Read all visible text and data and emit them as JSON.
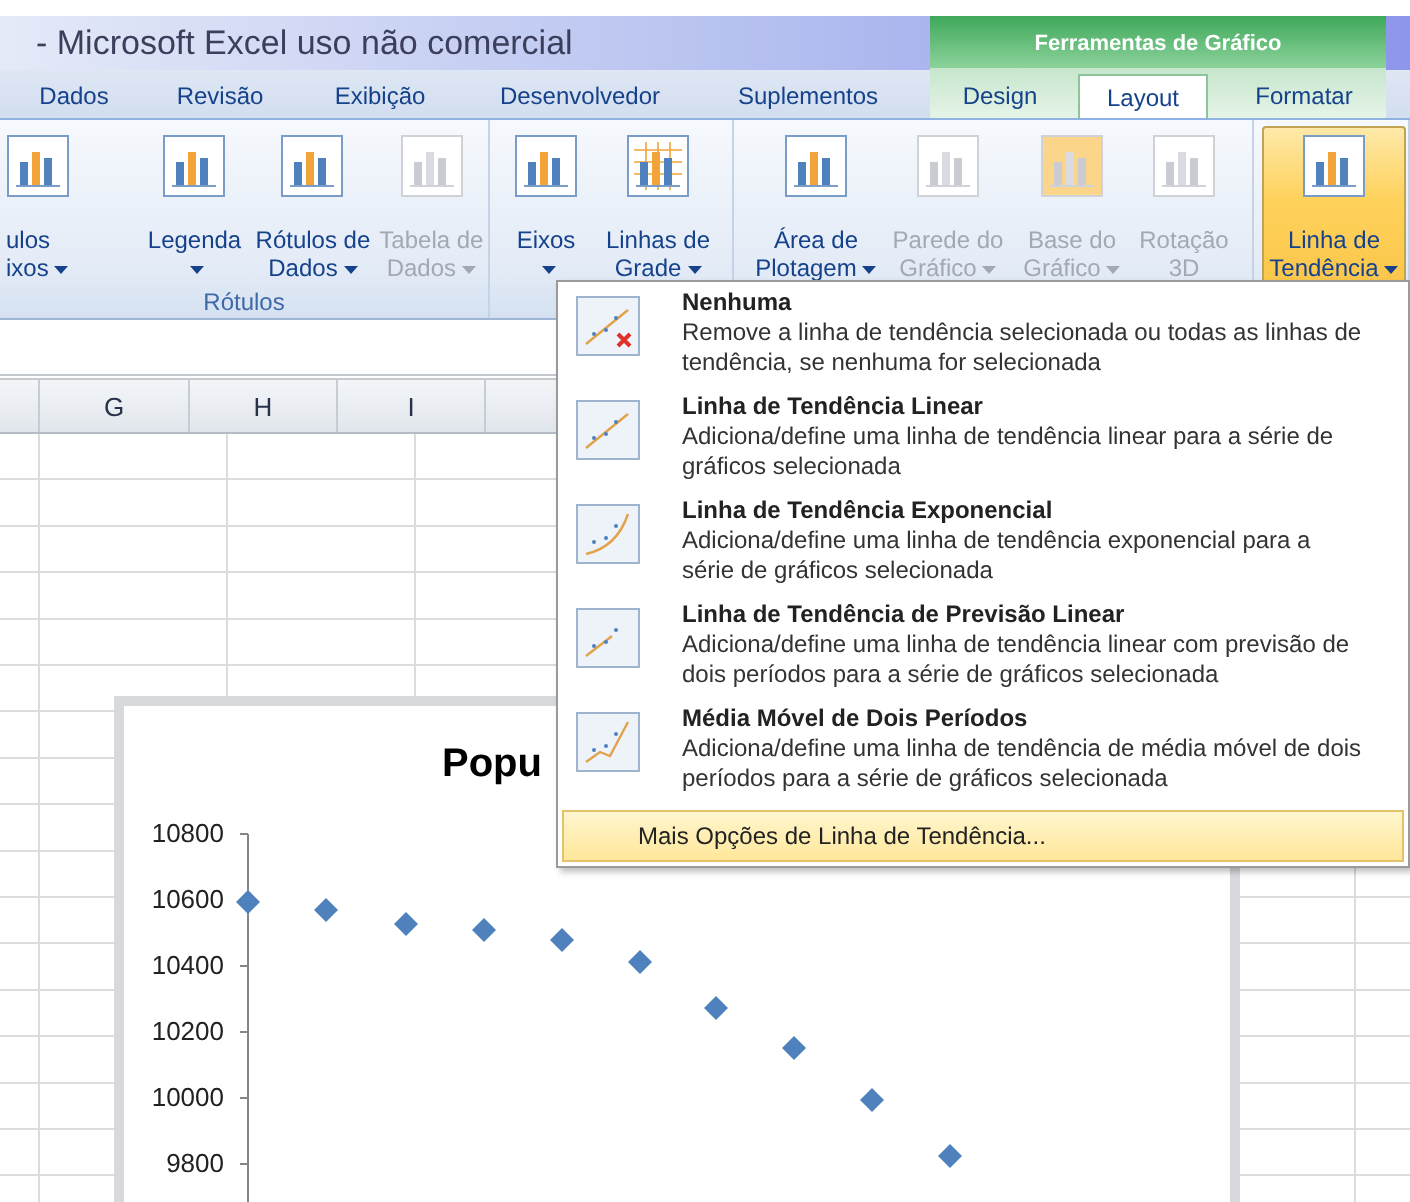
{
  "window": {
    "title": "- Microsoft Excel uso não comercial",
    "context_group": "Ferramentas de Gráfico"
  },
  "tabs": [
    {
      "label": "Dados",
      "selected": false,
      "contextual": false
    },
    {
      "label": "Revisão",
      "selected": false,
      "contextual": false
    },
    {
      "label": "Exibição",
      "selected": false,
      "contextual": false
    },
    {
      "label": "Desenvolvedor",
      "selected": false,
      "contextual": false
    },
    {
      "label": "Suplementos",
      "selected": false,
      "contextual": false
    },
    {
      "label": "Design",
      "selected": false,
      "contextual": true
    },
    {
      "label": "Layout",
      "selected": true,
      "contextual": true
    },
    {
      "label": "Formatar",
      "selected": false,
      "contextual": true
    }
  ],
  "ribbon": {
    "groups": [
      {
        "label": "Rótulos",
        "buttons": [
          {
            "lines": [
              "ulos",
              "ixos"
            ],
            "dropdown": true,
            "disabled": false,
            "active": false
          },
          {
            "lines": [
              "Legenda"
            ],
            "dropdown": true,
            "disabled": false,
            "active": false
          },
          {
            "lines": [
              "Rótulos de",
              "Dados"
            ],
            "dropdown": true,
            "disabled": false,
            "active": false
          },
          {
            "lines": [
              "Tabela de",
              "Dados"
            ],
            "dropdown": true,
            "disabled": true,
            "active": false
          }
        ]
      },
      {
        "buttons": [
          {
            "lines": [
              "Eixos"
            ],
            "dropdown": true,
            "disabled": false,
            "active": false
          },
          {
            "lines": [
              "Linhas de",
              "Grade"
            ],
            "dropdown": true,
            "disabled": false,
            "active": false
          }
        ]
      },
      {
        "buttons": [
          {
            "lines": [
              "Área de",
              "Plotagem"
            ],
            "dropdown": true,
            "disabled": false,
            "active": false
          },
          {
            "lines": [
              "Parede do",
              "Gráfico"
            ],
            "dropdown": true,
            "disabled": true,
            "active": false
          },
          {
            "lines": [
              "Base do",
              "Gráfico"
            ],
            "dropdown": true,
            "disabled": true,
            "active": false
          },
          {
            "lines": [
              "Rotação",
              "3D"
            ],
            "dropdown": false,
            "disabled": true,
            "active": false
          }
        ]
      },
      {
        "buttons": [
          {
            "lines": [
              "Linha de",
              "Tendência"
            ],
            "dropdown": true,
            "disabled": false,
            "active": true
          }
        ]
      }
    ]
  },
  "sheet": {
    "columns": [
      "G",
      "H",
      "I"
    ],
    "chart": {
      "title": "Popu",
      "y_labels": [
        "10800",
        "10600",
        "10400",
        "10200",
        "10000",
        "9800"
      ]
    }
  },
  "menu": {
    "items": [
      {
        "title": "Nenhuma",
        "description": "Remove a linha de tendência selecionada ou todas as linhas de tendência, se nenhuma for selecionada"
      },
      {
        "title": "Linha de Tendência Linear",
        "description": "Adiciona/define uma linha de tendência linear para a série de gráficos selecionada"
      },
      {
        "title": "Linha de Tendência Exponencial",
        "description": "Adiciona/define uma linha de tendência exponencial para a série de gráficos selecionada"
      },
      {
        "title": "Linha de Tendência de Previsão Linear",
        "description": "Adiciona/define uma linha de tendência linear com previsão de dois períodos para a série de gráficos selecionada"
      },
      {
        "title": "Média Móvel de Dois Períodos",
        "description": "Adiciona/define uma linha de tendência de média móvel de dois períodos para a série de gráficos selecionada"
      }
    ],
    "footer": {
      "label": "Mais Opções de Linha de Tendência...",
      "highlighted": true
    }
  }
}
